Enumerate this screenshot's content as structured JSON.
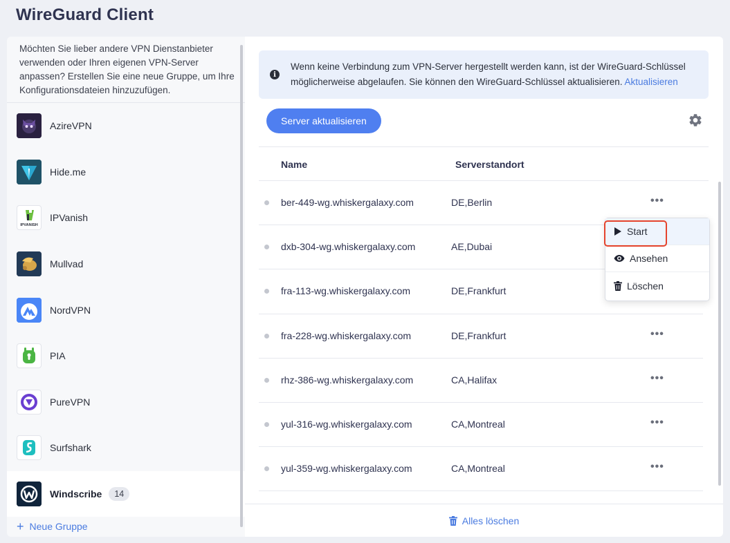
{
  "app": {
    "title": "WireGuard Client"
  },
  "sidebar": {
    "hint": "Möchten Sie lieber andere VPN Dienstanbieter verwenden oder Ihren eigenen VPN-Server anpassen? Erstellen Sie eine neue Gruppe, um Ihre Konfigurationsdateien hinzuzufügen.",
    "providers": [
      {
        "label": "AzireVPN",
        "icon": "azirevpn-logo"
      },
      {
        "label": "Hide.me",
        "icon": "hideme-logo"
      },
      {
        "label": "IPVanish",
        "icon": "ipvanish-logo",
        "logo_text": "IPVANISH"
      },
      {
        "label": "Mullvad",
        "icon": "mullvad-logo"
      },
      {
        "label": "NordVPN",
        "icon": "nordvpn-logo"
      },
      {
        "label": "PIA",
        "icon": "pia-logo"
      },
      {
        "label": "PureVPN",
        "icon": "purevpn-logo"
      },
      {
        "label": "Surfshark",
        "icon": "surfshark-logo"
      },
      {
        "label": "Windscribe",
        "icon": "windscribe-logo",
        "count": "14",
        "active": true
      }
    ],
    "new_group_label": "Neue Gruppe"
  },
  "main": {
    "info": {
      "text": "Wenn keine Verbindung zum VPN-Server hergestellt werden kann, ist der WireGuard-Schlüssel möglicherweise abgelaufen. Sie können den WireGuard-Schlüssel aktualisieren.",
      "link": "Aktualisieren"
    },
    "update_button": "Server aktualisieren",
    "table": {
      "headers": {
        "name": "Name",
        "location": "Serverstandort"
      },
      "rows": [
        {
          "name": "ber-449-wg.whiskergalaxy.com",
          "location": "DE,Berlin",
          "more": "•••"
        },
        {
          "name": "dxb-304-wg.whiskergalaxy.com",
          "location": "AE,Dubai",
          "more": ""
        },
        {
          "name": "fra-113-wg.whiskergalaxy.com",
          "location": "DE,Frankfurt",
          "more": ""
        },
        {
          "name": "fra-228-wg.whiskergalaxy.com",
          "location": "DE,Frankfurt",
          "more": "•••"
        },
        {
          "name": "rhz-386-wg.whiskergalaxy.com",
          "location": "CA,Halifax",
          "more": "•••"
        },
        {
          "name": "yul-316-wg.whiskergalaxy.com",
          "location": "CA,Montreal",
          "more": "•••"
        },
        {
          "name": "yul-359-wg.whiskergalaxy.com",
          "location": "CA,Montreal",
          "more": "•••"
        }
      ]
    },
    "footer": {
      "delete_all": "Alles löschen"
    }
  },
  "context_menu": {
    "items": [
      {
        "label": "Start",
        "icon": "play-icon"
      },
      {
        "label": "Ansehen",
        "icon": "eye-icon"
      },
      {
        "label": "Löschen",
        "icon": "trash-icon"
      }
    ]
  },
  "colors": {
    "accent": "#4f7ff0",
    "link": "#4a7be0",
    "highlight_outline": "#e5432c"
  }
}
